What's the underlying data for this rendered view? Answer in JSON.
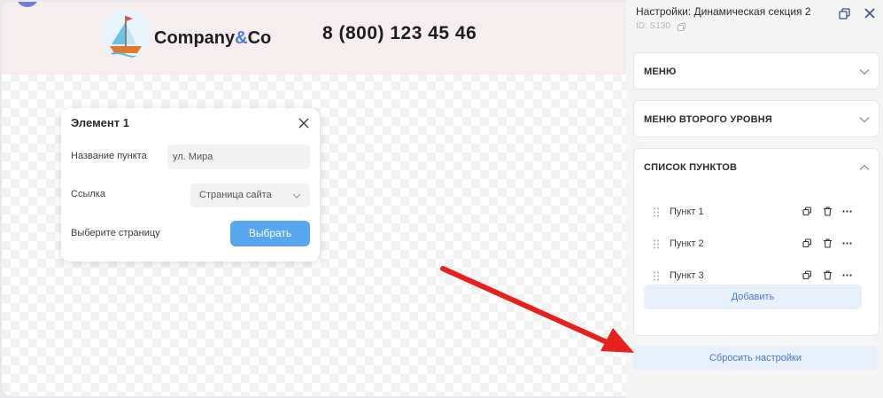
{
  "site": {
    "brand_main": "Company",
    "brand_amp": "&",
    "brand_tail": "Co",
    "phone": "8 (800) 123 45 46"
  },
  "popup": {
    "title": "Элемент 1",
    "name_label": "Название пункта",
    "name_value": "ул. Мира",
    "link_label": "Ссылка",
    "link_value": "Страница сайта",
    "page_label": "Выберите страницу",
    "choose_button": "Выбрать"
  },
  "panel": {
    "title": "Настройки: Динамическая секция 2",
    "id_text": "ID: S130",
    "sections": {
      "menu": "МЕНЮ",
      "submenu": "МЕНЮ ВТОРОГО УРОВНЯ",
      "items": "СПИСОК ПУНКТОВ"
    },
    "items": [
      "Пункт 1",
      "Пункт 2",
      "Пункт 3"
    ],
    "add_button": "Добавить",
    "reset_button": "Сбросить настройки"
  },
  "colors": {
    "accent": "#58a7ee",
    "header_bg": "#f6eeee",
    "annotation_arrow": "#e8201d"
  }
}
